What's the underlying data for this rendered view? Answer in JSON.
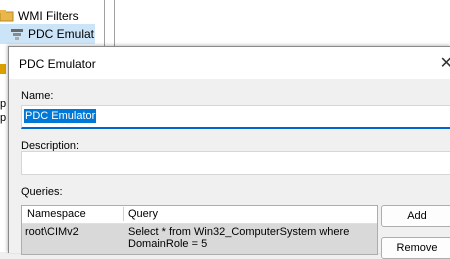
{
  "background": {
    "tree": {
      "items": [
        {
          "label": "WMI Filters"
        },
        {
          "label": "PDC Emulat"
        }
      ]
    }
  },
  "dialog": {
    "title": "PDC Emulator",
    "name_label": "Name:",
    "name_value": "PDC Emulator",
    "description_label": "Description:",
    "description_value": "",
    "queries_label": "Queries:",
    "queries": {
      "columns": [
        "Namespace",
        "Query"
      ],
      "rows": [
        {
          "namespace": "root\\CIMv2",
          "query_line1": "Select * from Win32_ComputerSystem where",
          "query_line2": "DomainRole = 5"
        }
      ]
    },
    "buttons": {
      "add": "Add",
      "remove": "Remove"
    }
  }
}
